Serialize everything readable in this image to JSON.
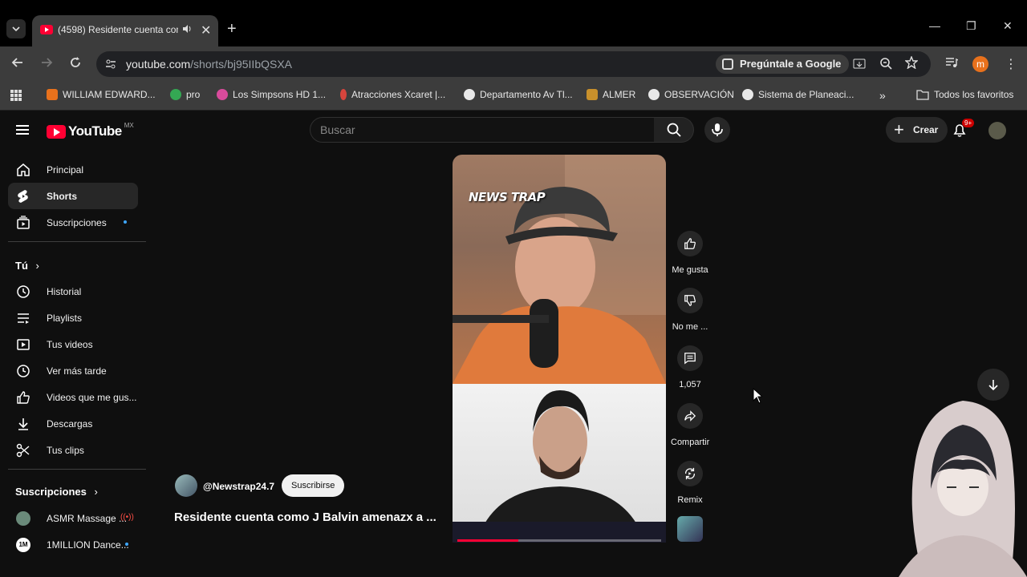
{
  "browser": {
    "tab_title": "(4598) Residente cuenta com",
    "url_host": "youtube.com",
    "url_path": "/shorts/bj95IIbQSXA",
    "ask_google": "Pregúntale a Google",
    "profile_initial": "m"
  },
  "bookmarks": [
    {
      "label": "WILLIAM EDWARD...",
      "color": "#e8711c"
    },
    {
      "label": "pro",
      "color": "#34a853"
    },
    {
      "label": "Los Simpsons HD 1...",
      "color": "#d94b9c"
    },
    {
      "label": "Atracciones Xcaret |...",
      "color": "#d6453d"
    },
    {
      "label": "Departamento Av Tl...",
      "color": "#e8e8e8"
    },
    {
      "label": "ALMER",
      "color": "#c8902b"
    },
    {
      "label": "OBSERVACIÓN",
      "color": "#e8e8e8"
    },
    {
      "label": "Sistema de Planeaci...",
      "color": "#e8e8e8"
    }
  ],
  "bookmarks_all": "Todos los favoritos",
  "youtube": {
    "logo": "YouTube",
    "country": "MX",
    "search_placeholder": "Buscar",
    "create_label": "Crear",
    "notif_count": "9+"
  },
  "sidebar": {
    "main": [
      {
        "label": "Principal",
        "icon": "home-icon"
      },
      {
        "label": "Shorts",
        "icon": "shorts-icon"
      },
      {
        "label": "Suscripciones",
        "icon": "subscriptions-icon"
      }
    ],
    "you_header": "Tú",
    "you": [
      {
        "label": "Historial",
        "icon": "history-icon"
      },
      {
        "label": "Playlists",
        "icon": "playlists-icon"
      },
      {
        "label": "Tus videos",
        "icon": "your-videos-icon"
      },
      {
        "label": "Ver más tarde",
        "icon": "watch-later-icon"
      },
      {
        "label": "Videos que me gus...",
        "icon": "liked-icon"
      },
      {
        "label": "Descargas",
        "icon": "downloads-icon"
      },
      {
        "label": "Tus clips",
        "icon": "clips-icon"
      }
    ],
    "subs_header": "Suscripciones",
    "subs": [
      {
        "label": "ASMR Massage ...",
        "color": "#6a8a7a"
      },
      {
        "label": "1MILLION Dance...",
        "color": "#ffffff"
      }
    ]
  },
  "short": {
    "overlay_text": "NEWS TRAP",
    "channel": "@Newstrap24.7",
    "subscribe": "Suscribirse",
    "title": "Residente cuenta como J Balvin amenazx a ...",
    "progress": 0.3
  },
  "actions": {
    "like": "Me gusta",
    "dislike": "No me ...",
    "comments": "1,057",
    "share": "Compartir",
    "remix": "Remix"
  }
}
